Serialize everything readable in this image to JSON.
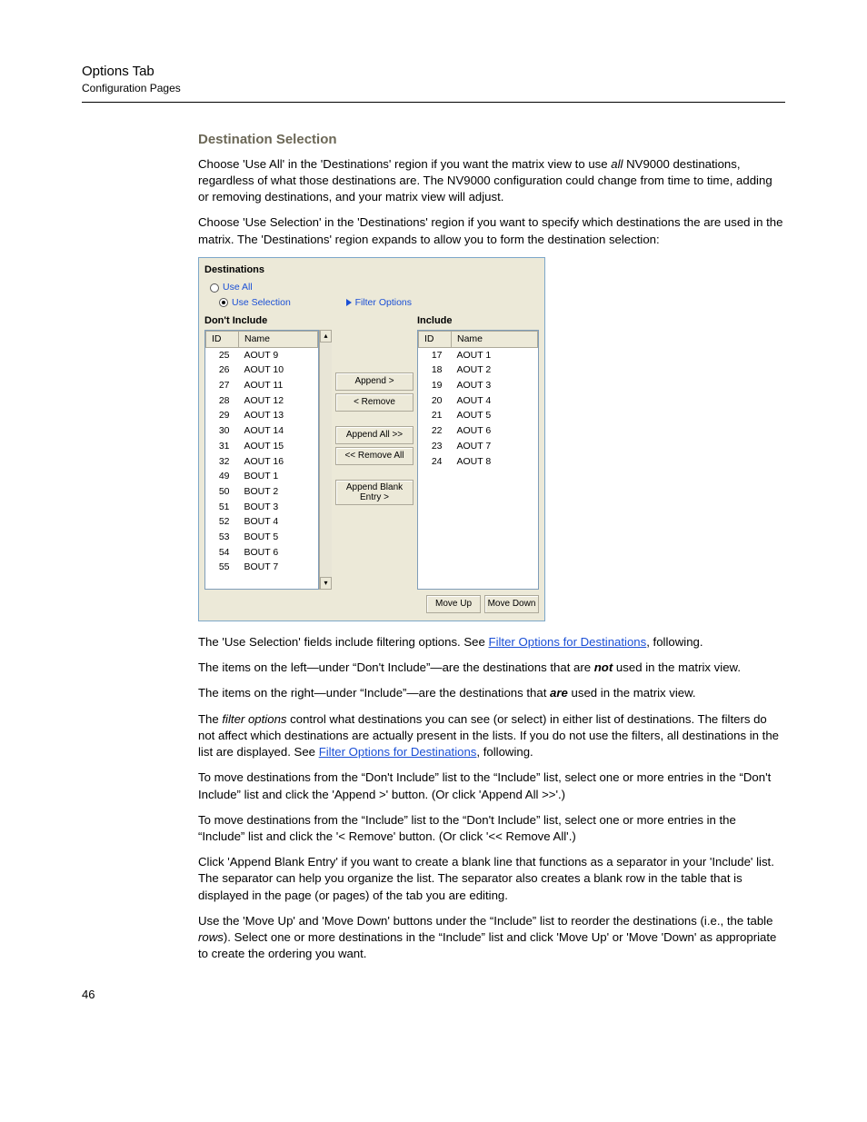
{
  "header": {
    "title": "Options Tab",
    "subtitle": "Configuration Pages"
  },
  "section_heading": "Destination Selection",
  "para": {
    "p1a": "Choose 'Use All' in the 'Destinations' region if you want the matrix view to use ",
    "p1b": "all",
    "p1c": " NV9000 destinations, regardless of what those destinations are. The NV9000 configuration could change from time to time, adding or removing destinations, and your matrix view will adjust.",
    "p2": "Choose 'Use Selection' in the 'Destinations' region if you want to specify which destinations the are used in the matrix. The 'Destinations' region expands to allow you to form the destination selection:",
    "p3a": "The 'Use Selection' fields include filtering options. See ",
    "p3link": "Filter Options for Destinations",
    "p3b": ", following.",
    "p4a": "The items on the left—under “Don't Include”—are the destinations that are ",
    "p4b": "not",
    "p4c": " used in the matrix view.",
    "p5a": "The items on the right—under “Include”—are the destinations that ",
    "p5b": "are",
    "p5c": " used in the matrix view.",
    "p6a": "The ",
    "p6b": "filter options",
    "p6c": " control what destinations you can see (or select) in either list of destinations. The filters do not affect which destinations are actually present in the lists. If you do not use the filters, all destinations in the list are displayed. See ",
    "p6link": "Filter Options for Destinations",
    "p6d": ", following.",
    "p7": "To move destinations from the “Don't Include” list to the “Include” list, select one or more entries in the “Don't Include” list and click the 'Append >' button. (Or click 'Append All >>'.)",
    "p8": "To move destinations from the “Include” list to the “Don't Include” list, select one or more entries in the “Include” list and click the '< Remove' button. (Or click '<< Remove All'.)",
    "p9": "Click 'Append Blank Entry' if you want to create a blank line that functions as a separator in your 'Include' list. The separator can help you organize the list. The separator also creates a blank row in the table that is displayed in the page (or pages) of the tab you are editing.",
    "p10a": "Use the 'Move Up' and 'Move Down' buttons under the “Include” list to reorder the destinations (i.e., the table ",
    "p10b": "rows",
    "p10c": "). Select one or more destinations in the “Include” list and click 'Move Up' or 'Move 'Down' as appropriate to create the ordering you want."
  },
  "shot": {
    "title": "Destinations",
    "radio_use_all": "Use All",
    "radio_use_selection": "Use Selection",
    "filter_options": "Filter Options",
    "dont_include": "Don't Include",
    "include": "Include",
    "col_id": "ID",
    "col_name": "Name",
    "left_rows": [
      {
        "id": "25",
        "name": "AOUT 9"
      },
      {
        "id": "26",
        "name": "AOUT 10"
      },
      {
        "id": "27",
        "name": "AOUT 11"
      },
      {
        "id": "28",
        "name": "AOUT 12"
      },
      {
        "id": "29",
        "name": "AOUT 13"
      },
      {
        "id": "30",
        "name": "AOUT 14"
      },
      {
        "id": "31",
        "name": "AOUT 15"
      },
      {
        "id": "32",
        "name": "AOUT 16"
      },
      {
        "id": "49",
        "name": "BOUT 1"
      },
      {
        "id": "50",
        "name": "BOUT 2"
      },
      {
        "id": "51",
        "name": "BOUT 3"
      },
      {
        "id": "52",
        "name": "BOUT 4"
      },
      {
        "id": "53",
        "name": "BOUT 5"
      },
      {
        "id": "54",
        "name": "BOUT 6"
      },
      {
        "id": "55",
        "name": "BOUT 7"
      }
    ],
    "right_rows": [
      {
        "id": "17",
        "name": "AOUT 1"
      },
      {
        "id": "18",
        "name": "AOUT 2"
      },
      {
        "id": "19",
        "name": "AOUT 3"
      },
      {
        "id": "20",
        "name": "AOUT 4"
      },
      {
        "id": "21",
        "name": "AOUT 5"
      },
      {
        "id": "22",
        "name": "AOUT 6"
      },
      {
        "id": "23",
        "name": "AOUT 7"
      },
      {
        "id": "24",
        "name": "AOUT 8"
      }
    ],
    "btn_append": "Append >",
    "btn_remove": "< Remove",
    "btn_append_all": "Append All >>",
    "btn_remove_all": "<< Remove All",
    "btn_append_blank": "Append Blank Entry >",
    "btn_move_up": "Move Up",
    "btn_move_down": "Move Down"
  },
  "page_number": "46"
}
